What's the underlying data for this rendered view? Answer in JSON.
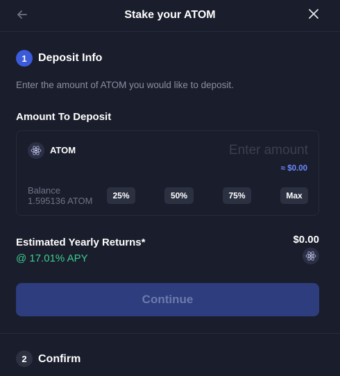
{
  "header": {
    "title": "Stake your ATOM",
    "back_icon": "arrow-left-icon",
    "close_icon": "close-icon"
  },
  "step1": {
    "number": "1",
    "label": "Deposit Info",
    "instructions": "Enter the amount of ATOM you would like to deposit."
  },
  "deposit": {
    "heading": "Amount To Deposit",
    "token_icon": "cosmos-atom-icon",
    "token": "ATOM",
    "input_placeholder": "Enter amount",
    "input_value": "",
    "usd_value": "≈ $0.00",
    "balance_label": "Balance",
    "balance_value": "1.595136 ATOM",
    "percent_buttons": [
      "25%",
      "50%",
      "75%",
      "Max"
    ]
  },
  "returns": {
    "label": "Estimated Yearly Returns*",
    "apy": "@ 17.01% APY",
    "value": "$0.00",
    "token_icon": "cosmos-atom-icon"
  },
  "continue_label": "Continue",
  "step2": {
    "number": "2",
    "label": "Confirm"
  },
  "colors": {
    "background": "#1a1d2b",
    "accent": "#3b5bdb",
    "apy_green": "#3ccf91",
    "usd_blue": "#6b8aff",
    "continue_disabled": "#2d3d7e"
  }
}
